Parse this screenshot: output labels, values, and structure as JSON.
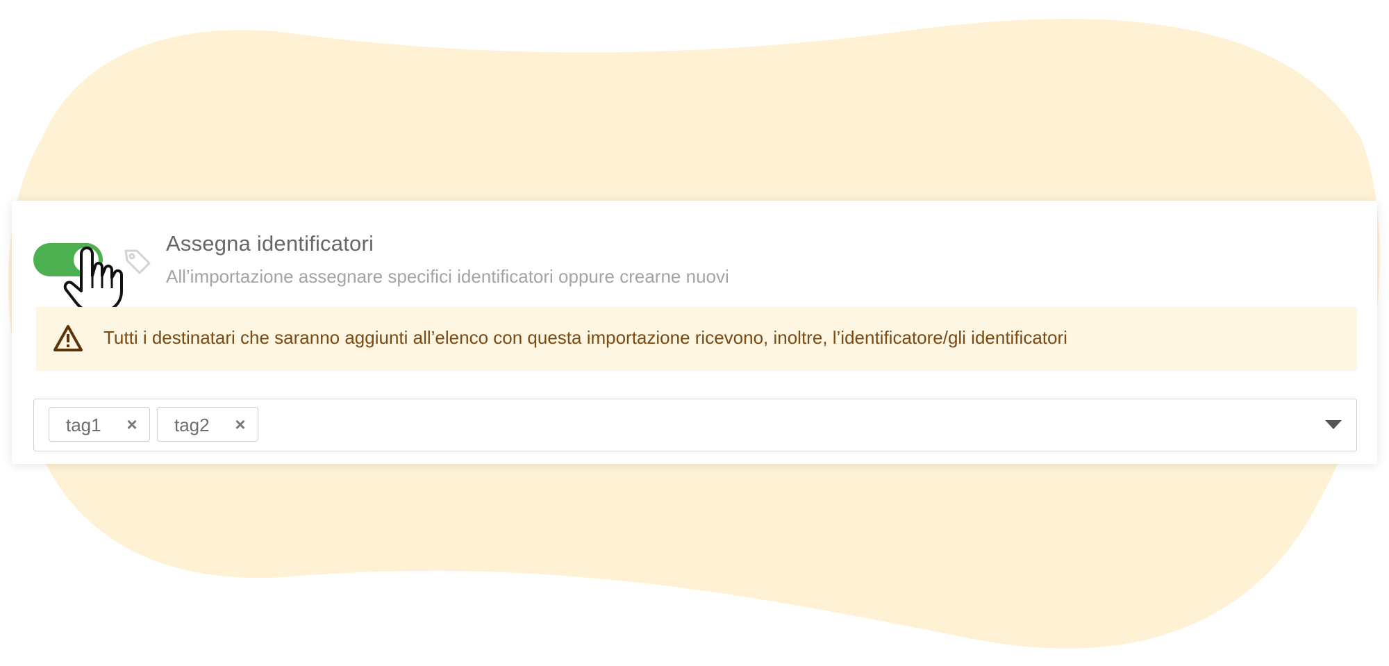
{
  "section": {
    "title": "Assegna identificatori",
    "description": "All’importazione assegnare specifici identificatori oppure crearne nuovi",
    "toggle_enabled": true
  },
  "warning": {
    "icon": "warning-triangle-icon",
    "text": "Tutti i destinatari che saranno aggiunti all’elenco con questa importazione ricevono, inoltre, l’identificatore/gli identificatori"
  },
  "tags_select": {
    "selected": [
      {
        "label": "tag1",
        "remove_symbol": "×"
      },
      {
        "label": "tag2",
        "remove_symbol": "×"
      }
    ],
    "dropdown_icon": "caret-down-icon"
  },
  "colors": {
    "background_blob": "#fef1d4",
    "toggle_on": "#4caf50",
    "warning_bg": "#fdf6e3",
    "warning_text": "#7a4a12"
  }
}
